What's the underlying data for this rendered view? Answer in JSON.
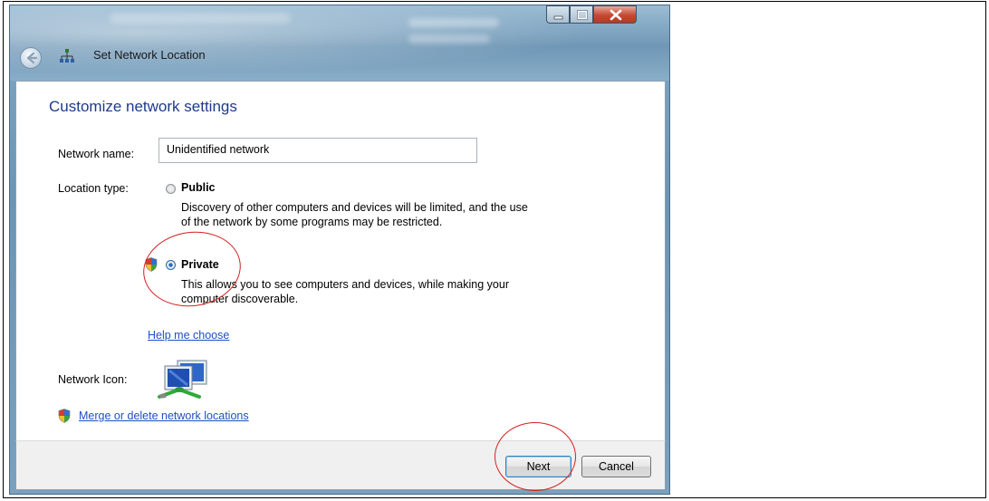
{
  "window": {
    "title": "Set Network Location",
    "heading": "Customize network settings"
  },
  "form": {
    "network_name_label": "Network name:",
    "network_name_value": "Unidentified network",
    "location_type_label": "Location type:",
    "options": [
      {
        "title": "Public",
        "description": "Discovery of other computers and devices will be limited, and the use of the network by some programs may be restricted.",
        "selected": false
      },
      {
        "title": "Private",
        "description": "This allows you to see computers and devices, while making your computer discoverable.",
        "selected": true
      }
    ],
    "help_link": "Help me choose",
    "network_icon_label": "Network Icon:",
    "merge_link": "Merge or delete network locations"
  },
  "footer": {
    "next_label": "Next",
    "cancel_label": "Cancel"
  },
  "annotation_color": "#d42020",
  "heading_color": "#1e3a8a",
  "link_color": "#1f4fc4"
}
